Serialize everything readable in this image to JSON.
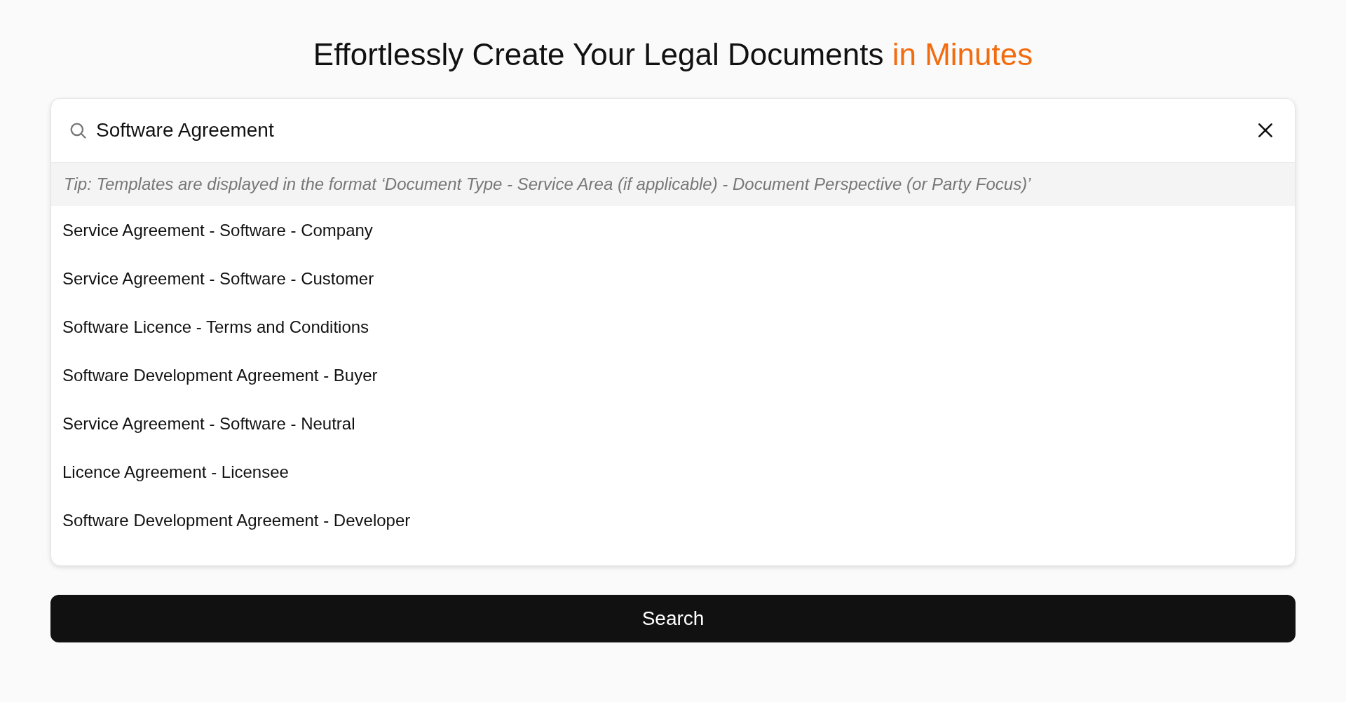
{
  "heading": {
    "text": "Effortlessly Create Your Legal Documents",
    "highlight": "in Minutes"
  },
  "search": {
    "value": "Software Agreement"
  },
  "tip": "Tip: Templates are displayed in the format ‘Document Type - Service Area (if applicable) - Document Perspective (or Party Focus)’",
  "results": [
    {
      "label": "Service Agreement - Software - Company"
    },
    {
      "label": "Service Agreement - Software - Customer"
    },
    {
      "label": "Software Licence - Terms and Conditions"
    },
    {
      "label": "Software Development Agreement - Buyer"
    },
    {
      "label": "Service Agreement - Software - Neutral"
    },
    {
      "label": "Licence Agreement - Licensee"
    },
    {
      "label": "Software Development Agreement - Developer"
    }
  ],
  "button": "Search"
}
